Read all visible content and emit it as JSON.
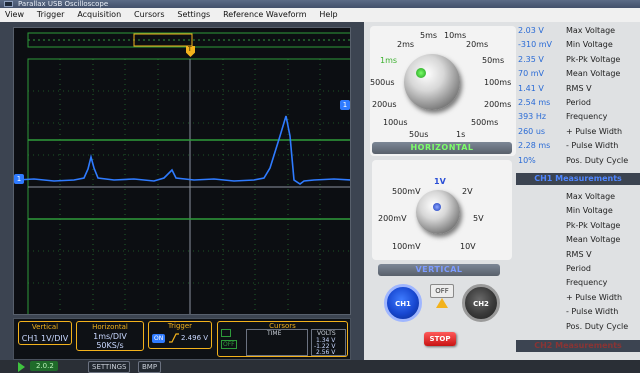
{
  "window": {
    "title": "Parallax USB Oscilloscope"
  },
  "menu": [
    "View",
    "Trigger",
    "Acquisition",
    "Cursors",
    "Settings",
    "Reference Waveform",
    "Help"
  ],
  "markers": {
    "trigger": "T",
    "ch_marker": "1"
  },
  "bottom": {
    "vertical": {
      "caption": "Vertical",
      "value": "CH1 1V/DIV"
    },
    "horizontal": {
      "caption": "Horizontal",
      "value1": "1ms/DIV",
      "value2": "50KS/s"
    },
    "trigger": {
      "caption": "Trigger",
      "mode": "ON",
      "level": "2.496 V"
    },
    "cursors": {
      "caption": "Cursors",
      "off_label": "OFF",
      "time_caption": "TIME",
      "volts_caption": "VOLTS",
      "volts": [
        "1.34 V",
        "-1.22 V",
        "2.56 V"
      ]
    },
    "footer": {
      "value": "2.0.2",
      "settings": "SETTINGS",
      "bmp": "BMP"
    }
  },
  "horizontal_knob": {
    "labels": [
      "1ms",
      "2ms",
      "5ms",
      "10ms",
      "20ms",
      "50ms",
      "100ms",
      "200ms",
      "500ms",
      "1s",
      "50us",
      "100us",
      "200us",
      "500us"
    ],
    "selected": "1ms",
    "title": "HORIZONTAL"
  },
  "vertical_knob": {
    "labels": [
      "1V",
      "2V",
      "5V",
      "10V",
      "100mV",
      "200mV",
      "500mV"
    ],
    "selected": "1V",
    "title": "VERTICAL"
  },
  "channels": {
    "ch1": "CH1",
    "ch2": "CH2",
    "off": "OFF",
    "stop": "STOP"
  },
  "ch1_measurements": {
    "header": "CH1 Measurements",
    "rows": [
      {
        "value": "2.03 V",
        "name": "Max Voltage"
      },
      {
        "value": "-310 mV",
        "name": "Min Voltage"
      },
      {
        "value": "2.35 V",
        "name": "Pk-Pk Voltage"
      },
      {
        "value": "70 mV",
        "name": "Mean Voltage"
      },
      {
        "value": "1.41 V",
        "name": "RMS V"
      },
      {
        "value": "2.54 ms",
        "name": "Period"
      },
      {
        "value": "393 Hz",
        "name": "Frequency"
      },
      {
        "value": "260 us",
        "name": "+ Pulse Width"
      },
      {
        "value": "2.28 ms",
        "name": "- Pulse Width"
      },
      {
        "value": "10%",
        "name": "Pos. Duty Cycle"
      }
    ]
  },
  "ch2_measurements": {
    "header": "CH2 Measurements",
    "rows": [
      "Max Voltage",
      "Min Voltage",
      "Pk-Pk Voltage",
      "Mean Voltage",
      "RMS V",
      "Period",
      "Frequency",
      "+ Pulse Width",
      "- Pulse Width",
      "Pos. Duty Cycle"
    ]
  },
  "colors": {
    "trace": "#2f7bff",
    "accent": "#f3b21c",
    "grid_green": "#2e9b3a",
    "measure_blue": "#2a6bd6"
  }
}
